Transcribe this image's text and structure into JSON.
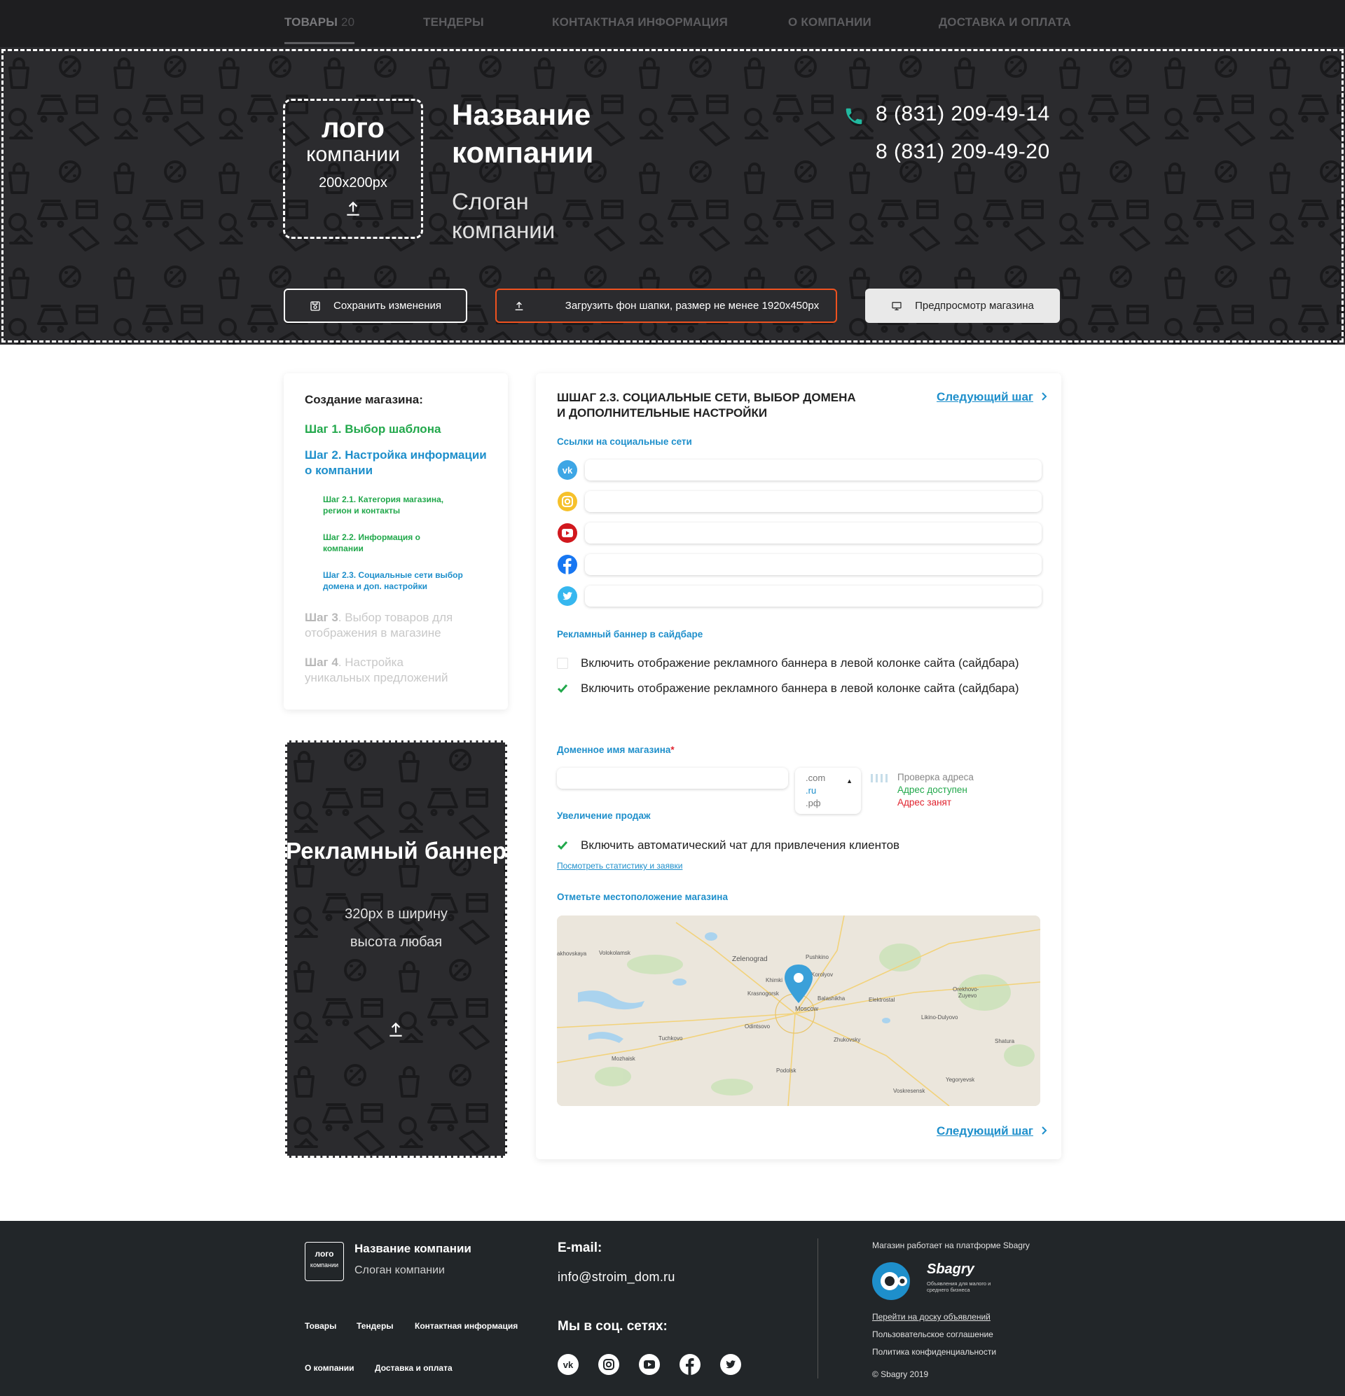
{
  "nav": {
    "items": [
      {
        "label": "ТОВАРЫ",
        "count": "20"
      },
      {
        "label": "ТЕНДЕРЫ"
      },
      {
        "label": "КОНТАКТНАЯ ИНФОРМАЦИЯ"
      },
      {
        "label": "О КОМПАНИИ"
      },
      {
        "label": "ДОСТАВКА И ОПЛАТА"
      }
    ]
  },
  "header": {
    "logo": {
      "line1": "лого",
      "line2": "компании",
      "size": "200x200px"
    },
    "company_name": "Название компании",
    "slogan": "Слоган компании",
    "phones": [
      "8 (831) 209-49-14",
      "8 (831) 209-49-20"
    ],
    "buttons": {
      "save": "Сохранить изменения",
      "upload": "Загрузить фон шапки, размер не менее 1920x450px",
      "preview": "Предпросмотр магазина"
    }
  },
  "sidebar": {
    "title": "Создание магазина:",
    "step1": "Шаг 1. Выбор шаблона",
    "step2": "Шаг 2. Настройка информации о компании",
    "sub1": "Шаг 2.1. Категория магазина, регион и контакты",
    "sub2": "Шаг 2.2. Информация о компании",
    "sub3": "Шаг 2.3. Социальные сети выбор домена и доп. настройки",
    "step3_num": "Шаг 3",
    "step3_text": ". Выбор товаров для отображения в магазине",
    "step4_num": "Шаг 4",
    "step4_text": ". Настройка уникальных предложений"
  },
  "banner": {
    "title": "Рекламный баннер",
    "line1": "320px в ширину",
    "line2": "высота любая"
  },
  "main": {
    "heading": "ШШАГ 2.3. СОЦИАЛЬНЫЕ СЕТИ, ВЫБОР ДОМЕНА И ДОПОЛНИТЕЛЬНЫЕ НАСТРОЙКИ",
    "next": "Следующий шаг",
    "social_label": "Ссылки на социальные сети",
    "social_inputs": [
      {
        "icon": "vk-icon",
        "value": ""
      },
      {
        "icon": "instagram-icon",
        "value": ""
      },
      {
        "icon": "youtube-icon",
        "value": ""
      },
      {
        "icon": "facebook-icon",
        "value": ""
      },
      {
        "icon": "twitter-icon",
        "value": ""
      }
    ],
    "banner_label": "Рекламный баннер в сайдбаре",
    "banner_opt1": {
      "label": "Включить отображение рекламного баннера в левой колонке сайта (сайдбара)",
      "checked": false
    },
    "banner_opt2": {
      "label": "Включить отображение рекламного баннера в левой колонке сайта (сайдбара)",
      "checked": true
    },
    "domain_label": "Доменное имя магазина",
    "domain_required": "*",
    "domain_value": "",
    "domain_options": [
      ".com",
      ".ru",
      ".рф"
    ],
    "domain_status": {
      "checking": "Проверка адреса",
      "available": "Адрес доступен",
      "taken": "Адрес занят"
    },
    "sales_label": "Увеличение продаж",
    "chat_opt": {
      "label": "Включить автоматический чат для привлечения клиентов",
      "checked": true
    },
    "stats_link": "Посмотреть статистику и заявки",
    "location_label": "Отметьте местоположение магазина",
    "map_labels": [
      "Zelenograd",
      "Khimki",
      "Krasnogorsk",
      "Moscow",
      "Balashikha",
      "Elektrostal",
      "Odintsovo",
      "Zhukovsky",
      "Podolsk",
      "Tuchkovo",
      "Mozhaisk",
      "Pushkino",
      "Korolyov",
      "Orekhovo-Zuyevo",
      "Likino-Dulyovo",
      "Shatura",
      "Yegoryevsk",
      "Voskresensk",
      "Volokolamsk",
      "Shakhovskaya"
    ]
  },
  "footer": {
    "logo": {
      "line1": "лого",
      "line2": "компании"
    },
    "name": "Название компании",
    "slogan": "Слоган компании",
    "links": [
      "Товары",
      "Тендеры",
      "Контактная информация",
      "О компании",
      "Доставка и оплата"
    ],
    "email_title": "E-mail:",
    "email": "info@stroim_dom.ru",
    "social_title": "Мы в соц. сетях:",
    "platform": "Магазин работает на платформе Sbagry",
    "brand": "Sbagry",
    "brand_tagline": "Объявления для малого и среднего бизнеса",
    "right_links": [
      "Перейти на доску объявлений",
      "Пользовательское соглашение",
      "Политика конфиденциальности"
    ],
    "copyright": "© Sbagry 2019"
  },
  "colors": {
    "green": "#21a84b",
    "blue": "#1e8fcb",
    "orange": "#f0521f",
    "red": "#e0232e",
    "dark": "#2b2b2e"
  }
}
